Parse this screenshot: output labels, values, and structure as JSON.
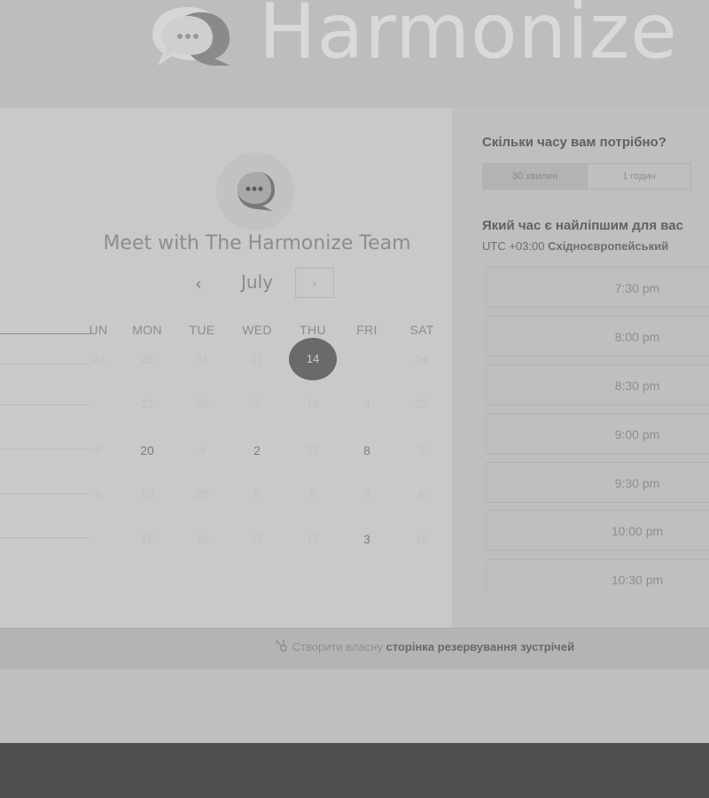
{
  "header": {
    "brand": "Harmonize"
  },
  "calendar": {
    "title": "Meet with The Harmonize Team",
    "month": "July",
    "prev": "‹",
    "next": "›",
    "weekdays": [
      "UN",
      "MON",
      "TUE",
      "WED",
      "THU",
      "FRI",
      "SAT"
    ],
    "selected_day": "14",
    "rows": [
      [
        "24",
        "25",
        "31",
        "17",
        "14",
        "",
        "24"
      ],
      [
        "",
        "21",
        "28",
        "7",
        "11",
        "4",
        "22"
      ],
      [
        "9",
        "20",
        "4",
        "2",
        "23",
        "8",
        "5"
      ],
      [
        "6",
        "10",
        "25",
        "5",
        "8",
        "9",
        "6"
      ],
      [
        "",
        "16",
        "10",
        "12",
        "17",
        "3",
        "19"
      ]
    ],
    "available_days": [
      {
        "row": 2,
        "col": 1,
        "value": "20"
      },
      {
        "row": 2,
        "col": 3,
        "value": "2"
      },
      {
        "row": 2,
        "col": 5,
        "value": "8"
      },
      {
        "row": 4,
        "col": 5,
        "value": "3"
      }
    ]
  },
  "booking": {
    "duration_question": "Скільки часу вам потрібно?",
    "durations": [
      "30 хвилин",
      "1 годин"
    ],
    "time_question": "Який час є найліпшим для вас",
    "timezone_offset": "UTC +03:00",
    "timezone_name": "Східноєвропейський",
    "slots": [
      "7:30 pm",
      "8:00 pm",
      "8:30 pm",
      "9:00 pm",
      "9:30 pm",
      "10:00 pm",
      "10:30 pm"
    ]
  },
  "footer": {
    "text": "Створити власну",
    "bold_text": "сторінка резервування зустрічей"
  },
  "colors": {
    "selected": "#6a6a6a",
    "panel": "#c9c9c9",
    "overlay": "#bfbfbf"
  }
}
